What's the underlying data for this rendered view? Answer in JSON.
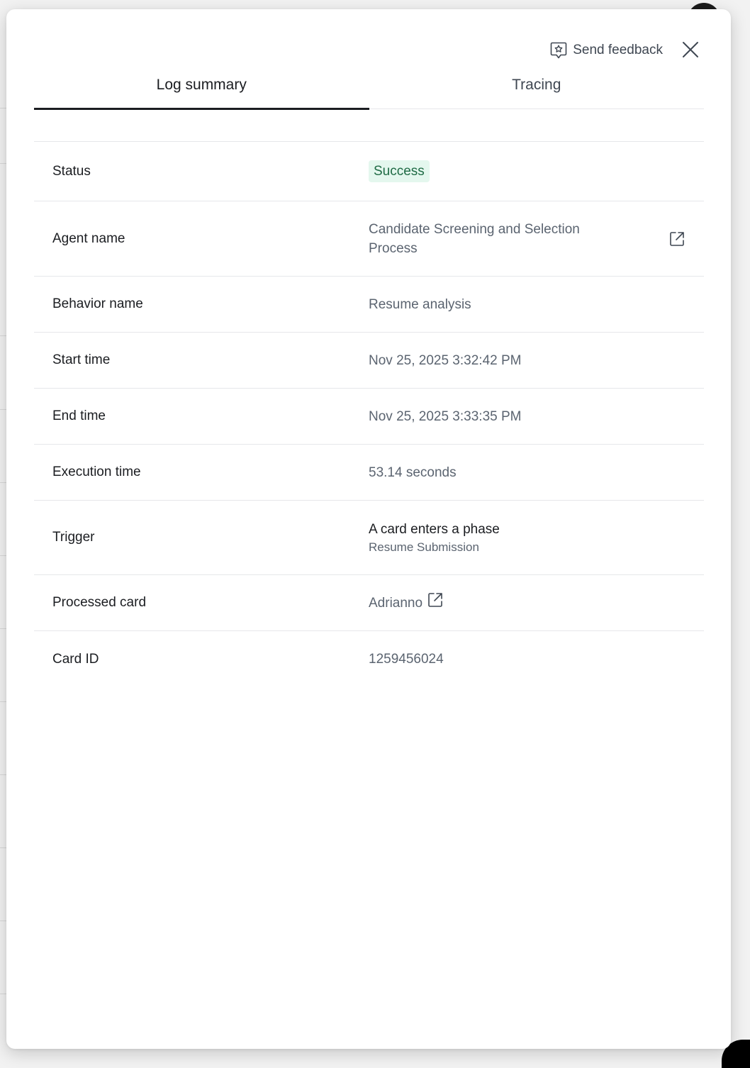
{
  "header": {
    "feedback_label": "Send feedback"
  },
  "tabs": [
    {
      "label": "Log summary",
      "active": true
    },
    {
      "label": "Tracing",
      "active": false
    }
  ],
  "summary": {
    "status": {
      "label": "Status",
      "value": "Success"
    },
    "agent_name": {
      "label": "Agent name",
      "value": "Candidate Screening and Selection Process"
    },
    "behavior_name": {
      "label": "Behavior name",
      "value": "Resume analysis"
    },
    "start_time": {
      "label": "Start time",
      "value": "Nov 25, 2025 3:32:42 PM"
    },
    "end_time": {
      "label": "End time",
      "value": "Nov 25, 2025 3:33:35 PM"
    },
    "execution_time": {
      "label": "Execution time",
      "value": "53.14 seconds"
    },
    "trigger": {
      "label": "Trigger",
      "value": "A card enters a phase",
      "detail": "Resume Submission"
    },
    "processed_card": {
      "label": "Processed card",
      "value": "Adrianno"
    },
    "card_id": {
      "label": "Card ID",
      "value": "1259456024"
    }
  },
  "colors": {
    "success_bg": "#e4f7ee",
    "success_text": "#1f6b45",
    "text_primary": "#1b1d21",
    "text_secondary": "#5b6470"
  },
  "icons": {
    "feedback": "star-chat-icon",
    "close": "close-icon",
    "external": "external-link-icon"
  }
}
